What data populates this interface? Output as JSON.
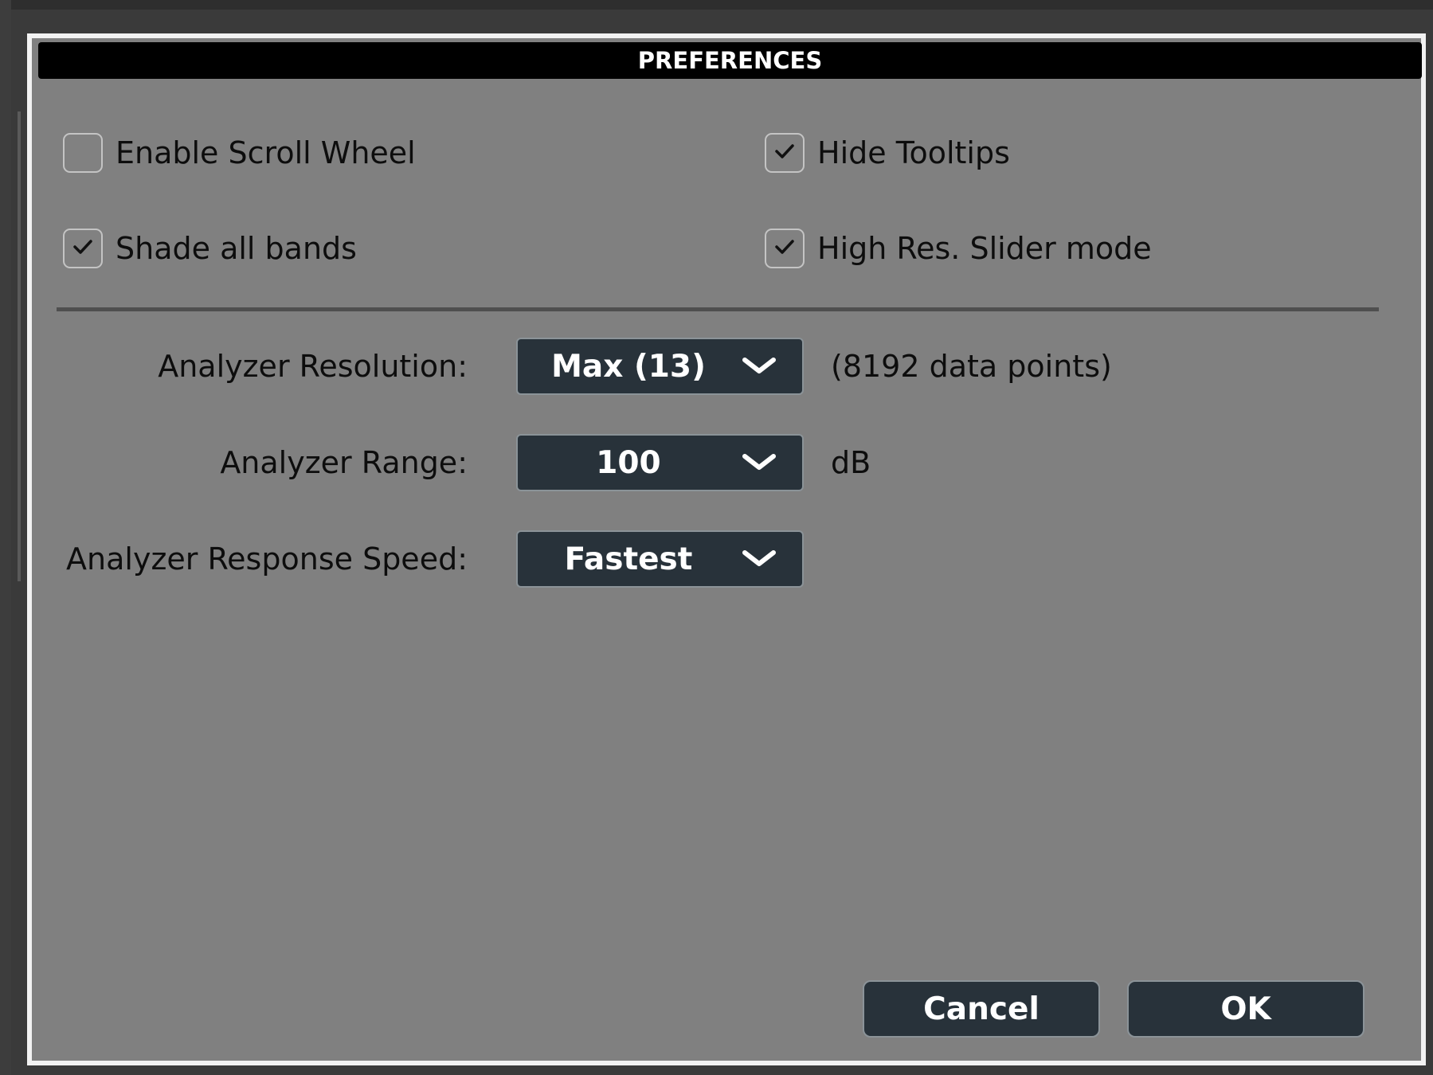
{
  "window": {
    "title": "PREFERENCES"
  },
  "checkboxes": [
    {
      "label": "Enable Scroll Wheel",
      "checked": false
    },
    {
      "label": "Hide Tooltips",
      "checked": true
    },
    {
      "label": "Shade all bands",
      "checked": true
    },
    {
      "label": "High Res. Slider mode",
      "checked": true
    }
  ],
  "fields": {
    "resolution": {
      "label": "Analyzer Resolution:",
      "value": "Max (13)",
      "suffix": "(8192 data points)"
    },
    "range": {
      "label": "Analyzer Range:",
      "value": "100",
      "suffix": "dB"
    },
    "speed": {
      "label": "Analyzer Response Speed:",
      "value": "Fastest"
    }
  },
  "buttons": {
    "cancel": "Cancel",
    "ok": "OK"
  },
  "icons": {
    "check": "checkmark-icon",
    "dropdown": "chevron-down-icon"
  },
  "colors": {
    "dialog_bg": "#808080",
    "titlebar_bg": "#000000",
    "control_bg": "#28323a",
    "frame": "#f2f2f2"
  }
}
